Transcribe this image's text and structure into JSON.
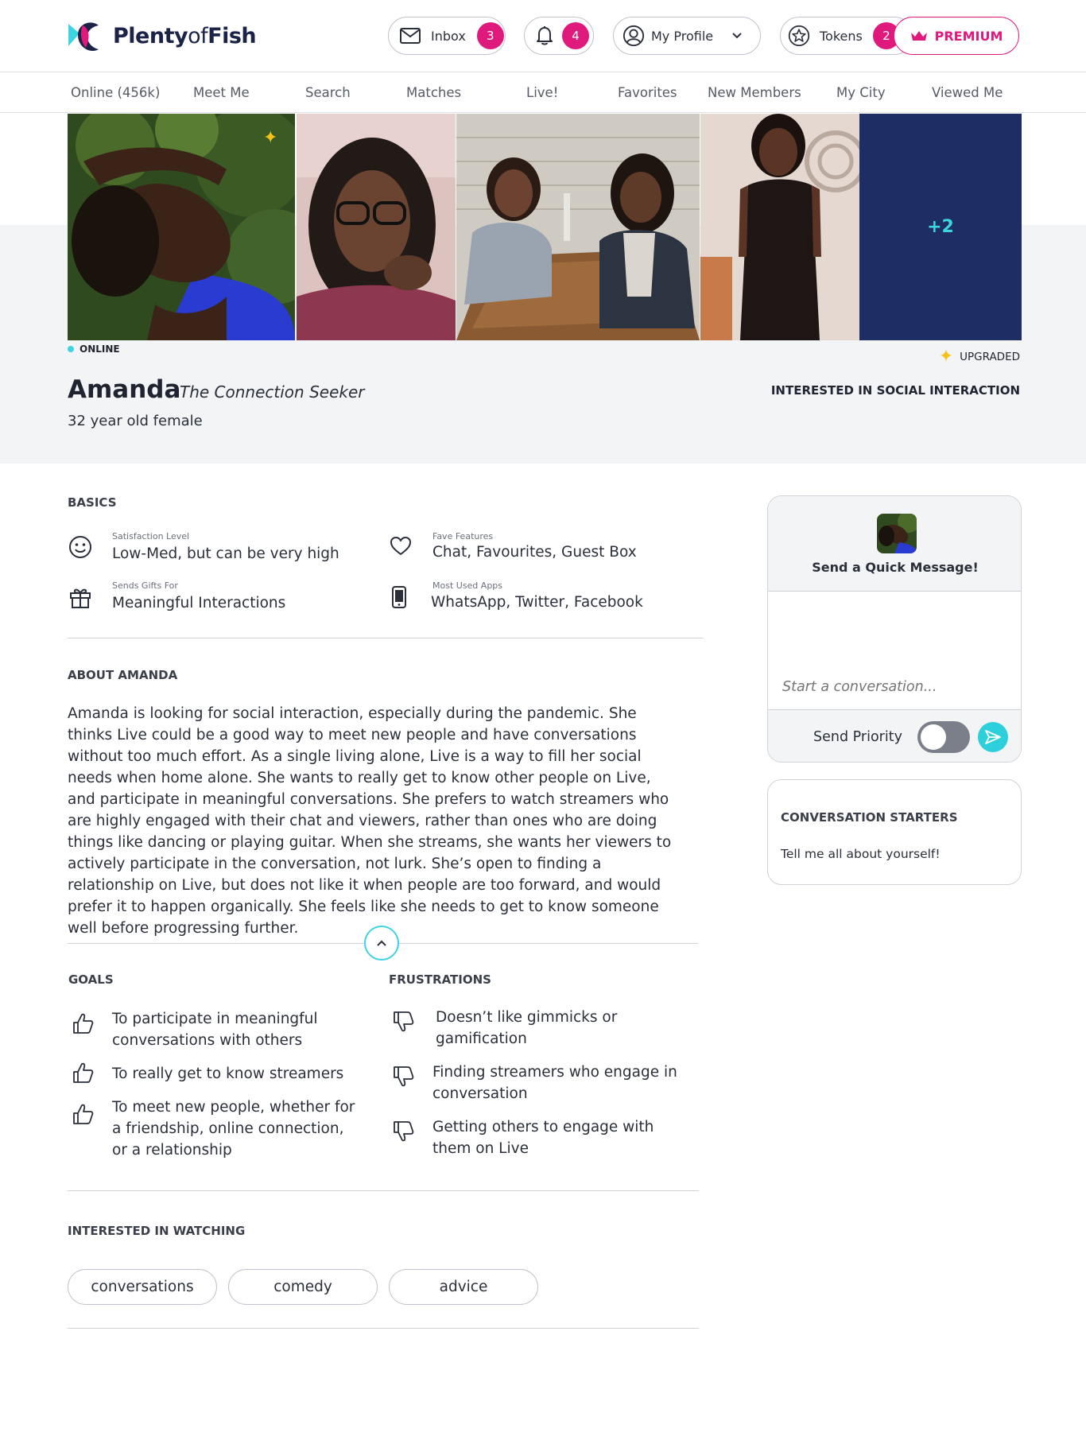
{
  "brand": {
    "logo_text_1": "Plenty",
    "logo_text_2": "of",
    "logo_text_3": "Fish"
  },
  "header": {
    "inbox_label": "Inbox",
    "inbox_count": "3",
    "notifications_count": "4",
    "profile_label": "My Profile",
    "tokens_label": "Tokens",
    "tokens_count": "2",
    "premium_label": "PREMIUM"
  },
  "nav": {
    "items": [
      "Online (456k)",
      "Meet Me",
      "Search",
      "Matches",
      "Live!",
      "Favorites",
      "New Members",
      "My City",
      "Viewed Me"
    ]
  },
  "gallery": {
    "more_count": "+2"
  },
  "profile": {
    "online_label": "ONLINE",
    "upgraded_label": "UPGRADED",
    "name": "Amanda",
    "tagline": "The Connection Seeker",
    "age_gender": "32 year old female",
    "interested_in": "INTERESTED IN SOCIAL INTERACTION"
  },
  "basics": {
    "title": "BASICS",
    "items": [
      {
        "label": "Satisfaction Level",
        "value": "Low-Med, but can be very high",
        "icon": "smiley-icon"
      },
      {
        "label": "Fave Features",
        "value": "Chat, Favourites, Guest Box",
        "icon": "heart-icon"
      },
      {
        "label": "Sends Gifts For",
        "value": "Meaningful Interactions",
        "icon": "gift-icon"
      },
      {
        "label": "Most Used Apps",
        "value": "WhatsApp, Twitter, Facebook",
        "icon": "phone-icon"
      }
    ]
  },
  "about": {
    "title": "ABOUT AMANDA",
    "text": "Amanda is looking for social interaction, especially during the pandemic. She thinks Live could be a good way to meet new people and have conversations without too much effort. As a single living alone, Live is a way to fill her social needs when home alone. She wants to really get to know other people on Live, and participate in meaningful conversations. She prefers to watch streamers who are highly engaged with their chat and viewers, rather than ones who are doing things like dancing or playing guitar. When she streams, she wants her viewers to actively participate in the conversation, not lurk. She’s open to finding a relationship on Live, but does not like it when people are too forward, and would prefer it to happen organically. She feels like she needs to get to know someone well before progressing further."
  },
  "goals": {
    "title": "GOALS",
    "items": [
      "To participate in meaningful conversations with others",
      "To really get to know streamers",
      "To meet new people, whether for a friendship, online connection, or a relationship"
    ]
  },
  "frustrations": {
    "title": "FRUSTRATIONS",
    "items": [
      "Doesn’t like gimmicks or gamification",
      "Finding streamers who engage in conversation",
      "Getting others to engage with them on Live"
    ]
  },
  "watching": {
    "title": "INTERESTED IN WATCHING",
    "tags": [
      "conversations",
      "comedy",
      "advice"
    ]
  },
  "quick_message": {
    "title": "Send a Quick Message!",
    "placeholder": "Start a conversation...",
    "priority_label": "Send Priority"
  },
  "starters": {
    "title": "CONVERSATION STARTERS",
    "item": "Tell me all about yourself!"
  },
  "colors": {
    "accent_pink": "#e0197d",
    "accent_cyan": "#3fd4e1",
    "brand_navy": "#1b2347"
  }
}
